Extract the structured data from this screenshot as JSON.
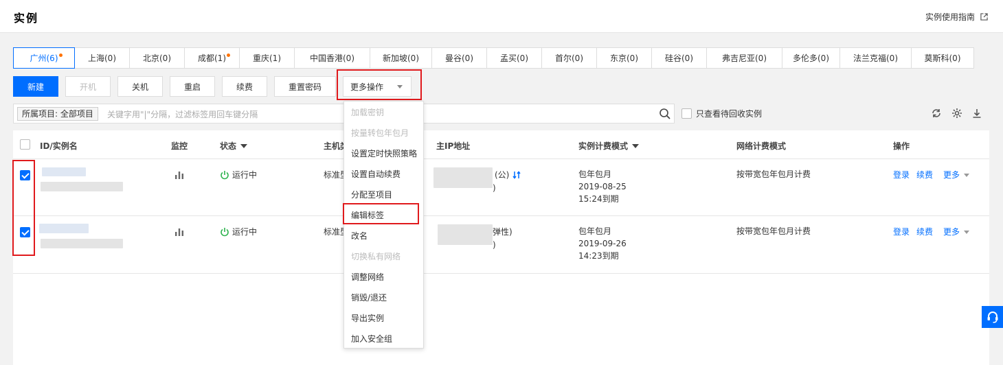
{
  "header": {
    "title": "实例",
    "guide_link": "实例使用指南"
  },
  "regions": [
    {
      "label": "广州(6)",
      "active": true,
      "dot": true
    },
    {
      "label": "上海(0)"
    },
    {
      "label": "北京(0)"
    },
    {
      "label": "成都(1)",
      "dot": true
    },
    {
      "label": "重庆(1)"
    },
    {
      "label": "中国香港(0)"
    },
    {
      "label": "新加坡(0)"
    },
    {
      "label": "曼谷(0)"
    },
    {
      "label": "孟买(0)"
    },
    {
      "label": "首尔(0)"
    },
    {
      "label": "东京(0)"
    },
    {
      "label": "硅谷(0)"
    },
    {
      "label": "弗吉尼亚(0)"
    },
    {
      "label": "多伦多(0)"
    },
    {
      "label": "法兰克福(0)"
    },
    {
      "label": "莫斯科(0)"
    }
  ],
  "toolbar": {
    "new": "新建",
    "start": "开机",
    "shutdown": "关机",
    "restart": "重启",
    "renew": "续费",
    "reset_password": "重置密码",
    "more_actions": "更多操作"
  },
  "search": {
    "project_tag": "所属项目: 全部项目",
    "placeholder": "关键字用\"|\"分隔，过滤标签用回车键分隔",
    "recycle_label": "只查看待回收实例"
  },
  "table": {
    "headers": {
      "id": "ID/实例名",
      "monitor": "监控",
      "status": "状态",
      "host": "主机类",
      "ip": "主IP地址",
      "billing": "实例计费模式",
      "network_billing": "网络计费模式",
      "actions": "操作"
    },
    "rows": [
      {
        "status": "运行中",
        "host": "标准型",
        "ip_suffix": "(公)",
        "ip_suffix2": ")",
        "billing_type": "包年包月",
        "billing_date": "2019-08-25",
        "billing_expire": "15:24到期",
        "network_billing": "按带宽包年包月计费",
        "login": "登录",
        "renew": "续费",
        "more": "更多"
      },
      {
        "status": "运行中",
        "host": "标准型",
        "ip_suffix": "弹性)",
        "ip_suffix2": ")",
        "billing_type": "包年包月",
        "billing_date": "2019-09-26",
        "billing_expire": "14:23到期",
        "network_billing": "按带宽包年包月计费",
        "login": "登录",
        "renew": "续费",
        "more": "更多"
      }
    ]
  },
  "dropdown": {
    "items": [
      {
        "label": "加载密钥",
        "disabled": true
      },
      {
        "label": "按量转包年包月",
        "disabled": true
      },
      {
        "label": "设置定时快照策略"
      },
      {
        "label": "设置自动续费"
      },
      {
        "label": "分配至项目"
      },
      {
        "label": "编辑标签"
      },
      {
        "label": "改名"
      },
      {
        "label": "切换私有网络",
        "disabled": true
      },
      {
        "label": "调整网络"
      },
      {
        "label": "销毁/退还"
      },
      {
        "label": "导出实例"
      },
      {
        "label": "加入安全组"
      }
    ]
  },
  "colors": {
    "accent": "#006eff",
    "highlight": "#e0191c",
    "dot": "#ff7200",
    "running": "#2bb24c"
  }
}
